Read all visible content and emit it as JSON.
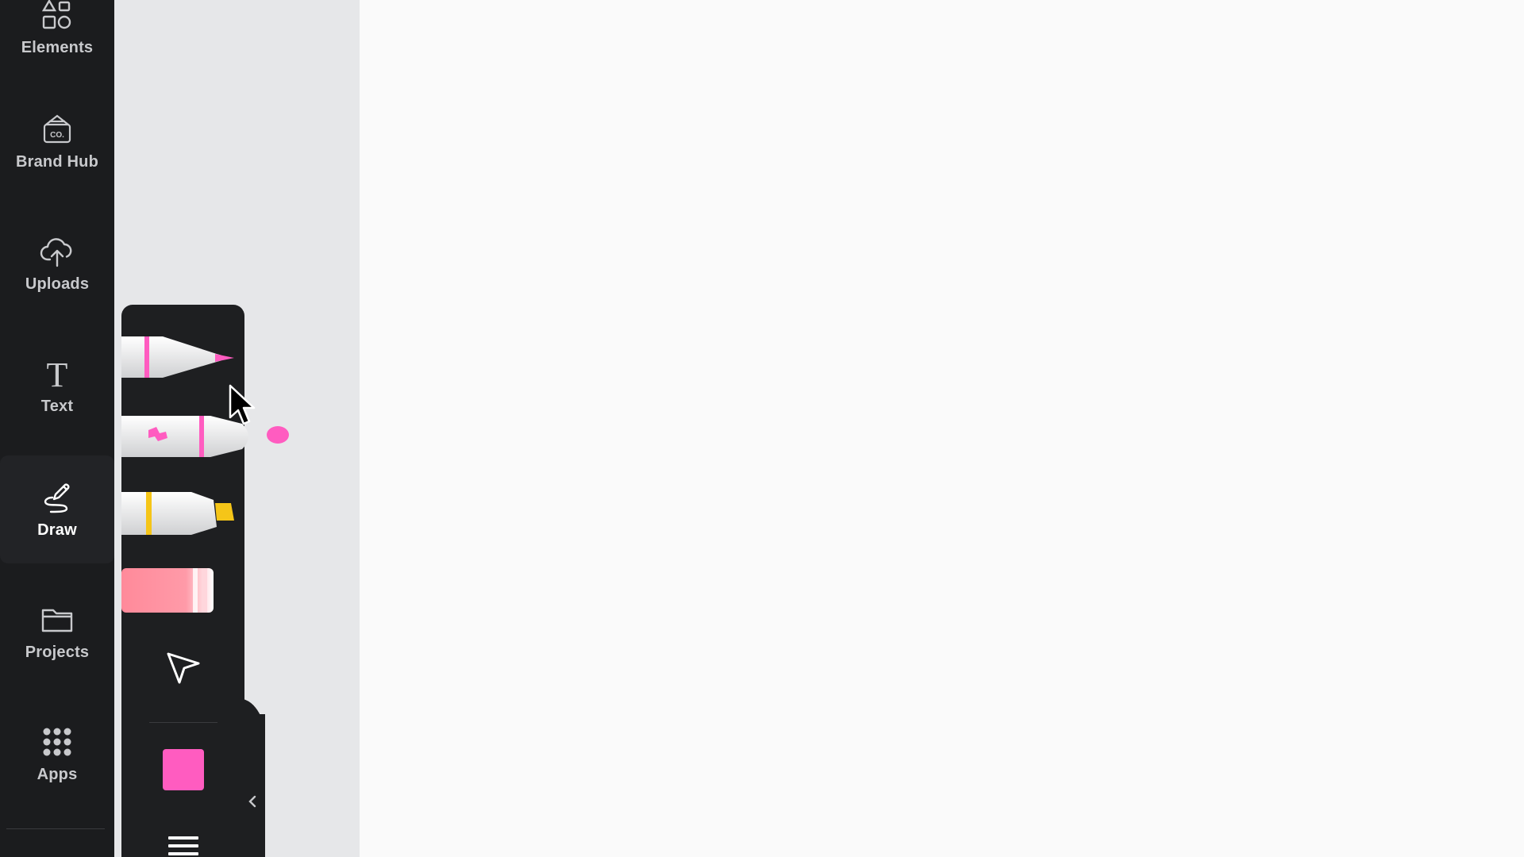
{
  "rail": {
    "items": [
      {
        "label": "Elements",
        "icon": "elements-icon"
      },
      {
        "label": "Brand Hub",
        "icon": "brand-hub-icon",
        "icon_text": "CO."
      },
      {
        "label": "Uploads",
        "icon": "cloud-upload-icon"
      },
      {
        "label": "Text",
        "icon": "text-icon",
        "icon_text": "T"
      },
      {
        "label": "Draw",
        "icon": "draw-icon",
        "active": true
      },
      {
        "label": "Projects",
        "icon": "folder-icon"
      },
      {
        "label": "Apps",
        "icon": "apps-grid-icon"
      }
    ]
  },
  "draw_tools": {
    "tools": [
      "pen",
      "marker",
      "highlighter",
      "eraser",
      "select"
    ],
    "selected_color": "#ff5cc0"
  },
  "colors": {
    "rail_bg": "#1b1c1e",
    "panel_bg": "#e6e7e9",
    "tray_bg": "#1e1f21",
    "canvas_bg": "#fafafa",
    "pink": "#ff5cc0",
    "yellow": "#f5c518",
    "eraser_pink": "#ff8a9a"
  }
}
